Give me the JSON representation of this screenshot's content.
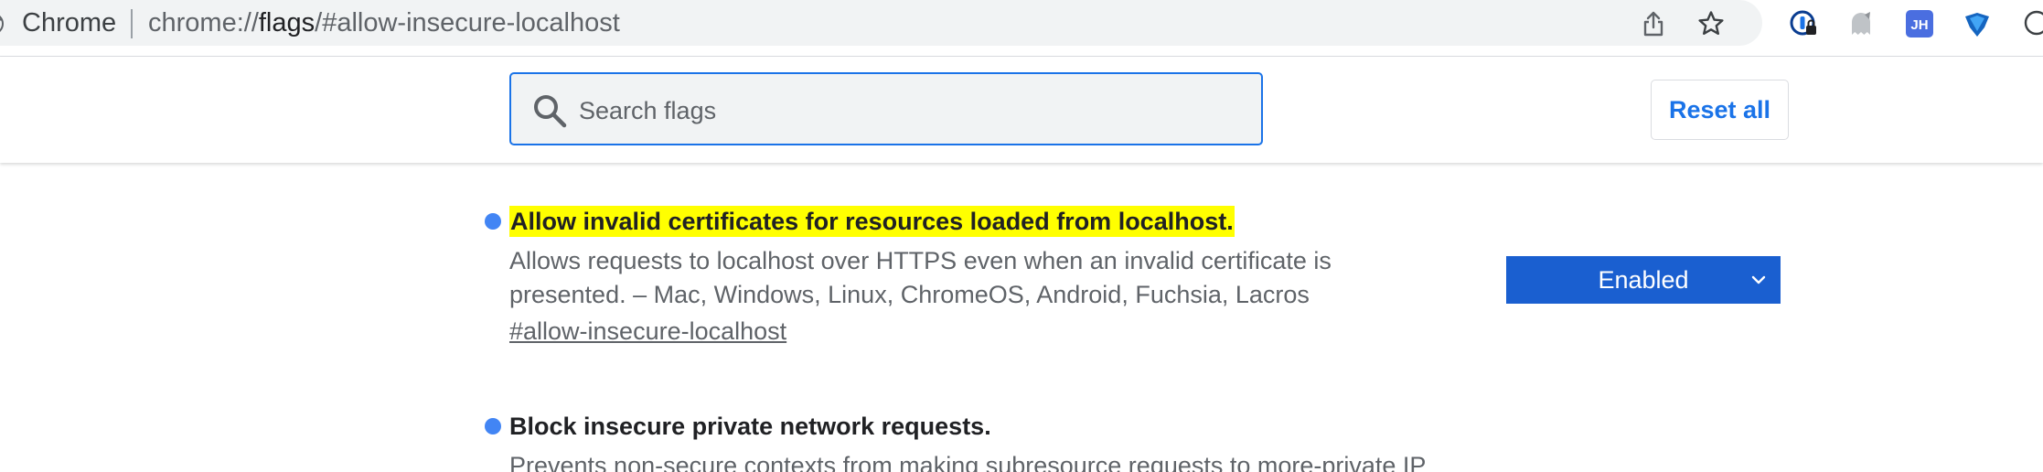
{
  "browser": {
    "site_chip": "Chrome",
    "url_prefix": "chrome://",
    "url_host": "flags",
    "url_rest": "/#allow-insecure-localhost",
    "toolbar_icons": [
      "share-icon",
      "bookmark-star-icon",
      "password-manager-extension-icon",
      "ghostery-extension-icon",
      "jh-extension-icon",
      "metamask-extension-icon",
      "chat-extension-icon"
    ]
  },
  "header": {
    "search_placeholder": "Search flags",
    "reset_label": "Reset all"
  },
  "flags": [
    {
      "title": "Allow invalid certificates for resources loaded from localhost.",
      "description": "Allows requests to localhost over HTTPS even when an invalid certificate is presented. – Mac, Windows, Linux, ChromeOS, Android, Fuchsia, Lacros",
      "link": "#allow-insecure-localhost",
      "state": "Enabled",
      "highlighted": true
    },
    {
      "title": "Block insecure private network requests.",
      "description": "Prevents non-secure contexts from making subresource requests to more-private IP"
    }
  ],
  "colors": {
    "accent": "#1a73e8",
    "select_bg": "#1a5fd0",
    "dot": "#4285f4",
    "highlight": "#ffff00"
  }
}
